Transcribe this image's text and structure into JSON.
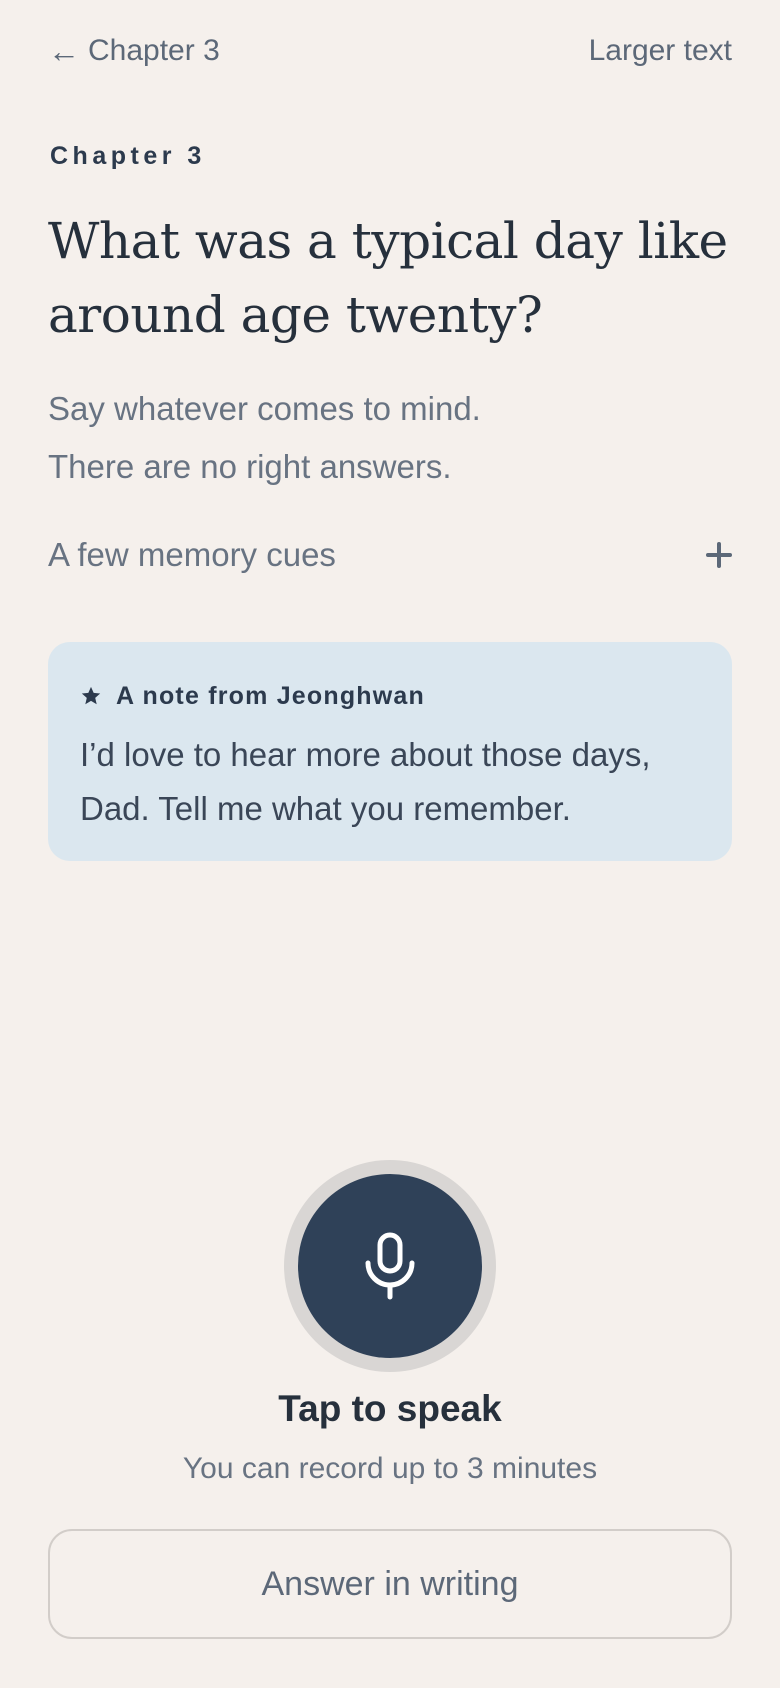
{
  "header": {
    "back_arrow": "←",
    "back_label": "Chapter 3",
    "larger_text_label": "Larger text"
  },
  "prompt": {
    "eyebrow": "Chapter 3",
    "question": "What was a typical day like around age twenty?",
    "subtext_lines": [
      "Say whatever comes to mind.",
      "There are no right answers."
    ]
  },
  "cues": {
    "label": "A few memory cues",
    "icon": "plus-icon"
  },
  "note": {
    "icon": "star-icon",
    "title": "A note from Jeonghwan",
    "body_lines": [
      "I’d love to hear more about those days,",
      "Dad. Tell me what you remember."
    ]
  },
  "recorder": {
    "icon": "microphone-icon",
    "tap_label": "Tap to speak",
    "limit_label": "You can record up to 3 minutes"
  },
  "actions": {
    "writing_label": "Answer in writing"
  },
  "colors": {
    "background": "#f5f0ec",
    "note_card": "#dbe7ef",
    "mic_button": "#2f4158",
    "mic_ring": "#d9d6d4",
    "primary_text": "#26303c",
    "muted_text": "#687382"
  }
}
